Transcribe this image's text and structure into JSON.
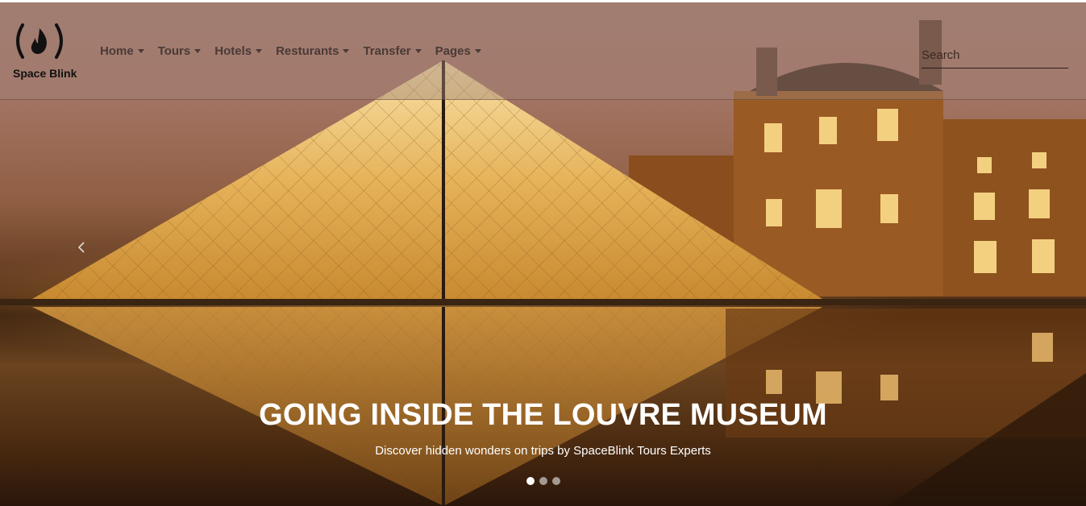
{
  "brand": {
    "name": "Space Blink",
    "logo_icon": "freecodecamp-flame-icon"
  },
  "nav": {
    "items": [
      {
        "label": "Home"
      },
      {
        "label": "Tours"
      },
      {
        "label": "Hotels"
      },
      {
        "label": "Resturants"
      },
      {
        "label": "Transfer"
      },
      {
        "label": "Pages"
      }
    ]
  },
  "search": {
    "placeholder": "Search",
    "value": ""
  },
  "carousel": {
    "title": "GOING INSIDE THE LOUVRE MUSEUM",
    "subtitle": "Discover hidden wonders on trips by SpaceBlink Tours Experts",
    "prev_icon": "chevron-left-icon",
    "slide_count": 3,
    "active_slide": 1
  },
  "colors": {
    "accent": "#ffffff",
    "nav_text": "#4a3a36",
    "sky": "#a3786c",
    "gold": "#e8b24a"
  }
}
